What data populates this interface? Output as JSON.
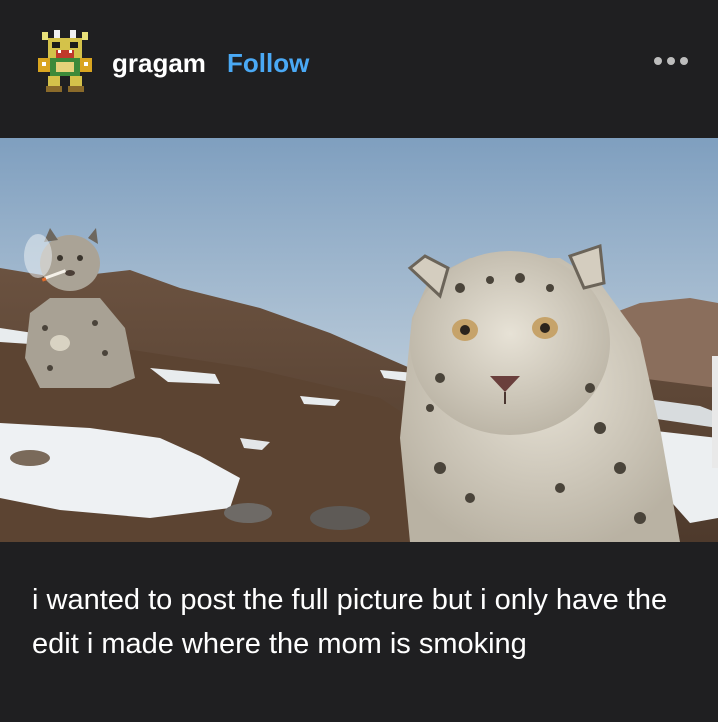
{
  "post": {
    "username": "gragam",
    "follow_label": "Follow",
    "more_icon": "more-horizontal-icon",
    "avatar_icon": "pixel-creature-avatar",
    "caption": "i wanted to post the full picture but i only have the edit i made where the mom is smoking"
  },
  "colors": {
    "background": "#1f1f21",
    "link": "#4aa9f5",
    "text": "#ffffff"
  }
}
